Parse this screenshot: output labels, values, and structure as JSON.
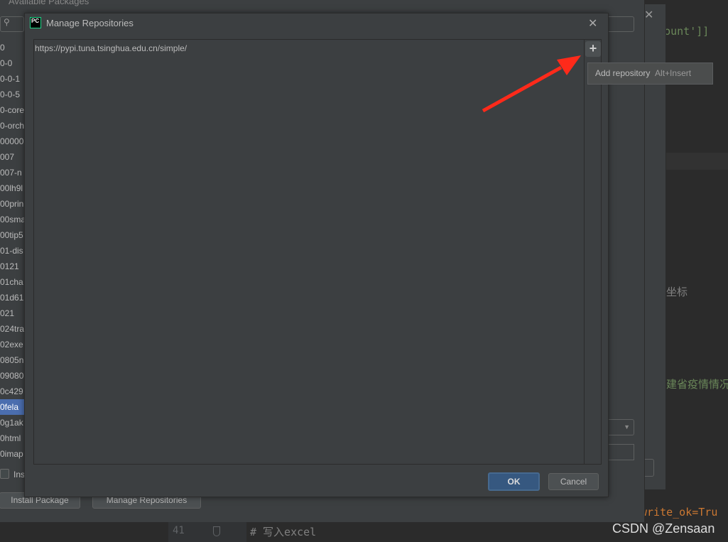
{
  "back_window": {
    "title": "Available Packages",
    "packages": [
      "0",
      "0-0",
      "0-0-1",
      "0-0-5",
      "0-core",
      "0-orch",
      "00000",
      "007",
      "007-n",
      "00lh9l",
      "00prin",
      "00sma",
      "00tip5",
      "01-dis",
      "0121",
      "01cha",
      "01d61",
      "021",
      "024tra",
      "02exe",
      "0805n",
      "09080",
      "0c429",
      "0fela",
      "0g1ak",
      "0html",
      "0imap"
    ],
    "selected": "0fela",
    "checkbox_label": "Ins",
    "install_button": "Install Package",
    "manage_button": "Manage Repositories"
  },
  "dialog": {
    "title": "Manage Repositories",
    "repositories": [
      "https://pypi.tuna.tsinghua.edu.cn/simple/"
    ],
    "add_tooltip": "Add repository",
    "add_shortcut": "Alt+Insert",
    "ok": "OK",
    "cancel": "Cancel"
  },
  "editor": {
    "line1": "edCount']]",
    "line2": "坐标",
    "line3": "建省疫情情况",
    "line4": "write_ok=Tru",
    "line_number": "41",
    "comment": "# 写入excel"
  },
  "watermark": "CSDN @Zensaan",
  "colors": {
    "accent": "#4b6eaf",
    "arrow": "#ff2a1a",
    "ok_button": "#365880"
  }
}
